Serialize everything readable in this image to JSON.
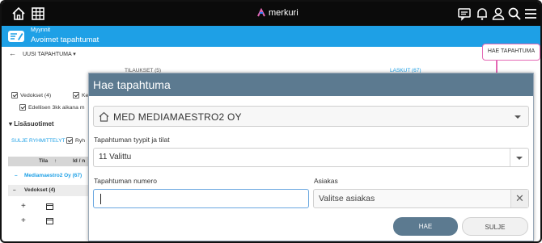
{
  "topbar": {
    "brand": "merkuri",
    "icons": [
      "home-icon",
      "grid-icon",
      "chat-icon",
      "bell-icon",
      "user-icon",
      "search-icon",
      "menu-icon"
    ]
  },
  "header": {
    "section": "Myynnit",
    "title": "Avoimet tapahtumat"
  },
  "actions": {
    "new_event": "UUSI TAPAHTUMA",
    "search_tab": "HAE TAPAHTUMA"
  },
  "tabs": {
    "orders": "TILAUKSET (5)",
    "invoices": "LASKUT (67)"
  },
  "left": {
    "vedokset_check": "Vedokset (4)",
    "ke_check": "Ke",
    "edellisen": "Edellisen 3kk aikana m",
    "lisasuotimet": "Lisäsuotimet",
    "sulje_ryhmittelyt": "SULJE RYHMITTELYT",
    "ryh": "Ryh",
    "col_tila": "Tila",
    "col_id": "Id / n",
    "group_media": "Mediamaestro2 Oy (67)",
    "group_vedokset": "Vedokset (4)"
  },
  "dialog": {
    "title": "Hae tapahtuma",
    "company": "MED MEDIAMAESTRO2 OY",
    "types_label": "Tapahtuman tyypit ja tilat",
    "types_value": "11 Valittu",
    "number_label": "Tapahtuman numero",
    "number_value": "",
    "customer_label": "Asiakas",
    "customer_placeholder": "Valitse asiakas",
    "clear_symbol": "✕",
    "search_button": "HAE",
    "close_button": "SULJE"
  },
  "colors": {
    "accent_blue": "#1ea0e6",
    "dialog_header": "#5c7a90",
    "highlight_pink": "#e468b4"
  }
}
